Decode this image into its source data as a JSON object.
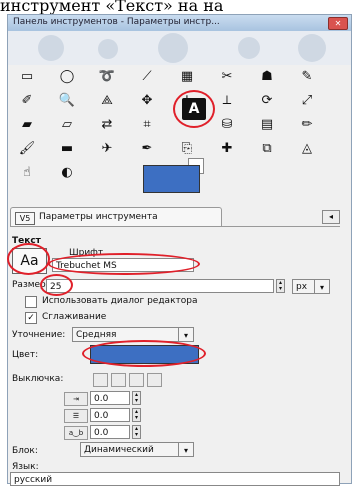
{
  "caption": "инструмент «Текст» на на",
  "window": {
    "title": "Панель инструментов - Параметры инстр...",
    "close": "✕"
  },
  "tools": [
    {
      "icon": "rect-select-icon",
      "glyph": "▭"
    },
    {
      "icon": "ellipse-select-icon",
      "glyph": "◯"
    },
    {
      "icon": "lasso-icon",
      "glyph": "➰"
    },
    {
      "icon": "wand-icon",
      "glyph": "⟋"
    },
    {
      "icon": "color-select-icon",
      "glyph": "▦"
    },
    {
      "icon": "scissors-icon",
      "glyph": "✂"
    },
    {
      "icon": "foreground-select-icon",
      "glyph": "☗"
    },
    {
      "icon": "paths-icon",
      "glyph": "✎"
    },
    {
      "icon": "color-picker-icon",
      "glyph": "✐"
    },
    {
      "icon": "zoom-icon",
      "glyph": "🔍"
    },
    {
      "icon": "measure-icon",
      "glyph": "⟁"
    },
    {
      "icon": "move-icon",
      "glyph": "✥"
    },
    {
      "icon": "align-icon",
      "glyph": "⊹"
    },
    {
      "icon": "crop-icon",
      "glyph": "⟂"
    },
    {
      "icon": "rotate-icon",
      "glyph": "⟳"
    },
    {
      "icon": "scale-icon",
      "glyph": "⤢"
    },
    {
      "icon": "shear-icon",
      "glyph": "▰"
    },
    {
      "icon": "perspective-icon",
      "glyph": "▱"
    },
    {
      "icon": "flip-icon",
      "glyph": "⇄"
    },
    {
      "icon": "cage-icon",
      "glyph": "⌗"
    },
    {
      "icon": "text-tool-icon",
      "glyph": "A"
    },
    {
      "icon": "bucket-fill-icon",
      "glyph": "⛁"
    },
    {
      "icon": "blend-icon",
      "glyph": "▤"
    },
    {
      "icon": "pencil-icon",
      "glyph": "✏"
    },
    {
      "icon": "paintbrush-icon",
      "glyph": "🖌"
    },
    {
      "icon": "eraser-icon",
      "glyph": "▬"
    },
    {
      "icon": "airbrush-icon",
      "glyph": "✈"
    },
    {
      "icon": "ink-icon",
      "glyph": "✒"
    },
    {
      "icon": "clone-icon",
      "glyph": "⎘"
    },
    {
      "icon": "heal-icon",
      "glyph": "✚"
    },
    {
      "icon": "perspective-clone-icon",
      "glyph": "⧉"
    },
    {
      "icon": "blur-icon",
      "glyph": "◬"
    },
    {
      "icon": "smudge-icon",
      "glyph": "☝"
    },
    {
      "icon": "dodge-icon",
      "glyph": "◐"
    }
  ],
  "colors": {
    "foreground": "#3d6fc2",
    "background": "#ffffff",
    "highlight": "#e0202a"
  },
  "tab": {
    "label": "Параметры инструмента"
  },
  "options": {
    "text_heading": "Текст",
    "font_label": "Шрифт",
    "font_button": "Aa",
    "font_value": "Trebuchet MS",
    "size_label": "Размер:",
    "size_value": "25",
    "size_unit": "px",
    "use_editor_label": "Использовать диалог редактора",
    "antialias_label": "Сглаживание",
    "hinting_label": "Уточнение:",
    "hinting_value": "Средняя",
    "color_label": "Цвет:",
    "justify_label": "Выключка:",
    "indent_value": "0.0",
    "line_spacing_value": "0.0",
    "letter_spacing_value": "0.0",
    "box_label": "Блок:",
    "box_value": "Динамический",
    "language_label": "Язык:",
    "language_value": "русский"
  }
}
